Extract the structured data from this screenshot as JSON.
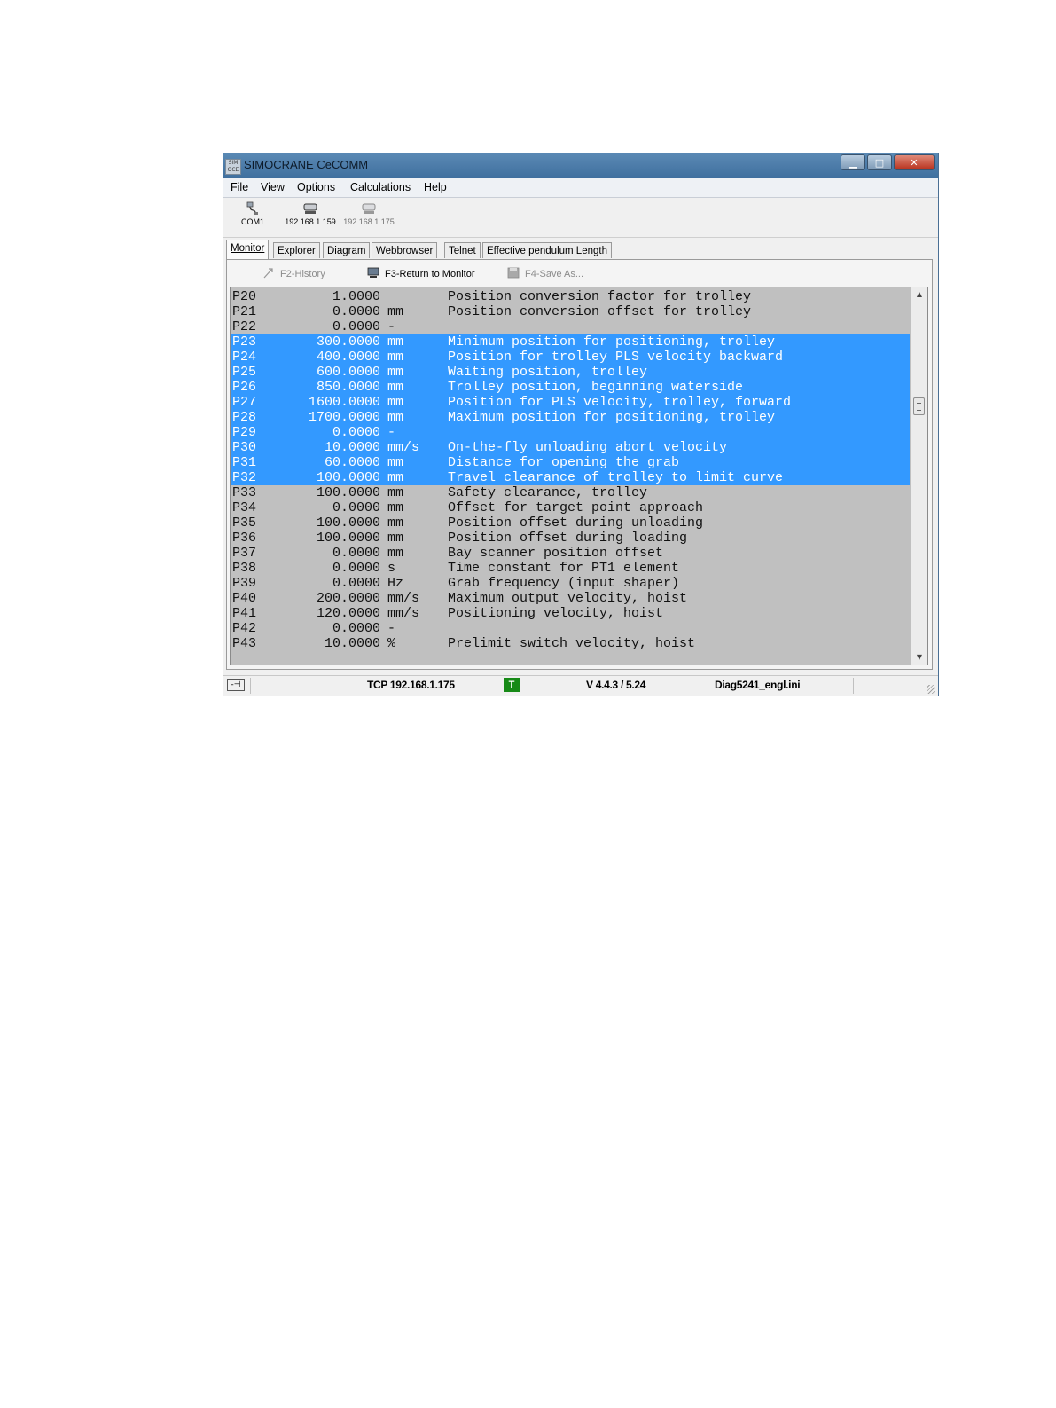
{
  "window": {
    "title": "SIMOCRANE CeCOMM",
    "app_icon_text": "SIM OCE"
  },
  "menu": [
    "File",
    "View",
    "Options",
    "Calculations",
    "Help"
  ],
  "toolbar": [
    {
      "label": "COM1",
      "icon": "serial-cable-icon",
      "enabled": true
    },
    {
      "label": "192.168.1.159",
      "icon": "network-device-icon",
      "enabled": true
    },
    {
      "label": "192.168.1.175",
      "icon": "network-device-icon",
      "enabled": false
    }
  ],
  "tabs": [
    "Monitor",
    "Explorer",
    "Diagram",
    "Webbrowser",
    "Telnet",
    "Effective pendulum Length"
  ],
  "active_tab": "Monitor",
  "subtoolbar": [
    {
      "label": "F2-History",
      "icon": "history-icon",
      "enabled": false
    },
    {
      "label": "F3-Return to Monitor",
      "icon": "monitor-icon",
      "enabled": true
    },
    {
      "label": "F4-Save As...",
      "icon": "save-icon",
      "enabled": false
    }
  ],
  "parameters": [
    {
      "id": "P20",
      "value": "1.0000",
      "unit": "",
      "desc": "Position conversion factor for trolley",
      "selected": false
    },
    {
      "id": "P21",
      "value": "0.0000",
      "unit": "mm",
      "desc": "Position conversion offset for trolley",
      "selected": false
    },
    {
      "id": "P22",
      "value": "0.0000",
      "unit": "-",
      "desc": "",
      "selected": false
    },
    {
      "id": "P23",
      "value": "300.0000",
      "unit": "mm",
      "desc": "Minimum position for positioning, trolley",
      "selected": true
    },
    {
      "id": "P24",
      "value": "400.0000",
      "unit": "mm",
      "desc": "Position for trolley PLS velocity backward",
      "selected": true
    },
    {
      "id": "P25",
      "value": "600.0000",
      "unit": "mm",
      "desc": "Waiting position, trolley",
      "selected": true
    },
    {
      "id": "P26",
      "value": "850.0000",
      "unit": "mm",
      "desc": "Trolley position, beginning waterside",
      "selected": true
    },
    {
      "id": "P27",
      "value": "1600.0000",
      "unit": "mm",
      "desc": "Position for PLS velocity, trolley, forward",
      "selected": true
    },
    {
      "id": "P28",
      "value": "1700.0000",
      "unit": "mm",
      "desc": "Maximum position for positioning, trolley",
      "selected": true
    },
    {
      "id": "P29",
      "value": "0.0000",
      "unit": "-",
      "desc": "",
      "selected": true
    },
    {
      "id": "P30",
      "value": "10.0000",
      "unit": "mm/s",
      "desc": "On-the-fly unloading abort velocity",
      "selected": true
    },
    {
      "id": "P31",
      "value": "60.0000",
      "unit": "mm",
      "desc": "Distance for opening the grab",
      "selected": true
    },
    {
      "id": "P32",
      "value": "100.0000",
      "unit": "mm",
      "desc": "Travel clearance of trolley to limit curve",
      "selected": true
    },
    {
      "id": "P33",
      "value": "100.0000",
      "unit": "mm",
      "desc": "Safety clearance, trolley",
      "selected": false
    },
    {
      "id": "P34",
      "value": "0.0000",
      "unit": "mm",
      "desc": "Offset for target point approach",
      "selected": false
    },
    {
      "id": "P35",
      "value": "100.0000",
      "unit": "mm",
      "desc": "Position offset during unloading",
      "selected": false
    },
    {
      "id": "P36",
      "value": "100.0000",
      "unit": "mm",
      "desc": "Position offset during loading",
      "selected": false
    },
    {
      "id": "P37",
      "value": "0.0000",
      "unit": "mm",
      "desc": "Bay scanner position offset",
      "selected": false
    },
    {
      "id": "P38",
      "value": "0.0000",
      "unit": "s",
      "desc": "Time constant for PT1 element",
      "selected": false
    },
    {
      "id": "P39",
      "value": "0.0000",
      "unit": "Hz",
      "desc": "Grab frequency (input shaper)",
      "selected": false
    },
    {
      "id": "P40",
      "value": "200.0000",
      "unit": "mm/s",
      "desc": "Maximum output velocity, hoist",
      "selected": false
    },
    {
      "id": "P41",
      "value": "120.0000",
      "unit": "mm/s",
      "desc": "Positioning velocity, hoist",
      "selected": false
    },
    {
      "id": "P42",
      "value": "0.0000",
      "unit": "-",
      "desc": "",
      "selected": false
    },
    {
      "id": "P43",
      "value": "10.0000",
      "unit": "%",
      "desc": "Prelimit switch velocity, hoist",
      "selected": false
    }
  ],
  "statusbar": {
    "connection": "TCP 192.168.1.175",
    "indicator": "T",
    "version": "V 4.4.3 / 5.24",
    "ini_file": "Diag5241_engl.ini"
  },
  "colors": {
    "selection": "#3399ff",
    "list_background": "#c0c0c0",
    "status_indicator": "#178a17"
  }
}
